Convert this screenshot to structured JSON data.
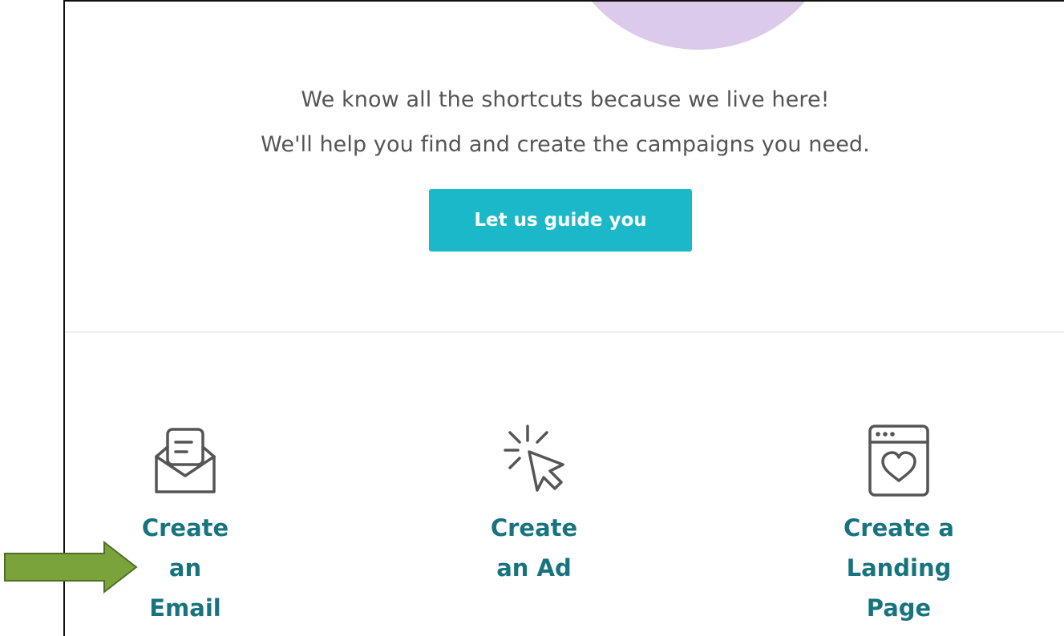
{
  "intro": {
    "line1": "We know all the shortcuts because we live here!",
    "line2": "We'll help you find and create the campaigns you need."
  },
  "guide_button": {
    "label": "Let us guide you"
  },
  "options": [
    {
      "label_lines": [
        "Create",
        "an",
        "Email"
      ],
      "icon": "open-envelope-icon"
    },
    {
      "label_lines": [
        "Create",
        "an Ad"
      ],
      "icon": "cursor-click-icon"
    },
    {
      "label_lines": [
        "Create a",
        "Landing",
        "Page"
      ],
      "icon": "browser-heart-icon"
    }
  ],
  "annotation": {
    "icon": "pointer-arrow",
    "color": "#7aa33b"
  },
  "colors": {
    "accent_button": "#1ab8c8",
    "link_teal": "#17747e",
    "decor_circle": "#dccaeb"
  }
}
